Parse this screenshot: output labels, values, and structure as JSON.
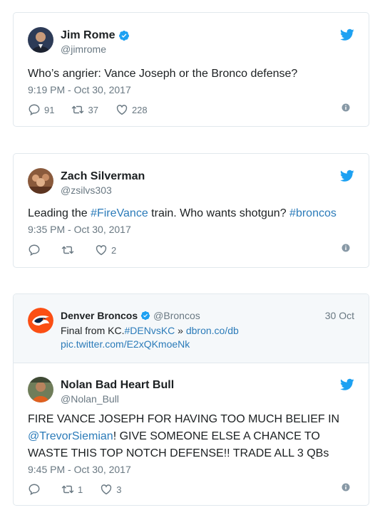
{
  "colors": {
    "link": "#2b7bb9",
    "muted": "#697882",
    "twitter_blue": "#1da1f2",
    "border": "#e1e8ed"
  },
  "tweets": [
    {
      "name": "Jim Rome",
      "handle": "@jimrome",
      "verified": true,
      "text": "Who’s angrier: Vance Joseph or the Bronco defense?",
      "time": "9:19 PM - Oct 30, 2017",
      "replies": "91",
      "retweets": "37",
      "likes": "228"
    },
    {
      "name": "Zach Silverman",
      "handle": "@zsilvs303",
      "verified": false,
      "text_parts": [
        "Leading the ",
        "#FireVance",
        " train. Who wants shotgun? ",
        "#broncos"
      ],
      "time": "9:35 PM - Oct 30, 2017",
      "replies": "",
      "retweets": "",
      "likes": "2"
    },
    {
      "quoted": {
        "name": "Denver Broncos",
        "handle": "@Broncos",
        "verified": true,
        "date": "30 Oct",
        "line1_parts": [
          "Final from KC.",
          "#DENvsKC",
          " » ",
          "dbron.co/db"
        ],
        "line2": "pic.twitter.com/E2xQKmoeNk"
      },
      "name": "Nolan Bad Heart Bull",
      "handle": "@Nolan_Bull",
      "verified": false,
      "text_parts": [
        "FIRE VANCE JOSEPH FOR HAVING TOO MUCH BELIEF IN ",
        "@TrevorSiemian",
        "! GIVE SOMEONE ELSE A CHANCE TO WASTE THIS TOP NOTCH DEFENSE!! TRADE ALL 3 QBs"
      ],
      "time": "9:45 PM - Oct 30, 2017",
      "replies": "",
      "retweets": "1",
      "likes": "3"
    }
  ],
  "icons": [
    "reply-icon",
    "retweet-icon",
    "like-icon",
    "info-icon",
    "twitter-bird-icon",
    "verified-badge-icon"
  ]
}
